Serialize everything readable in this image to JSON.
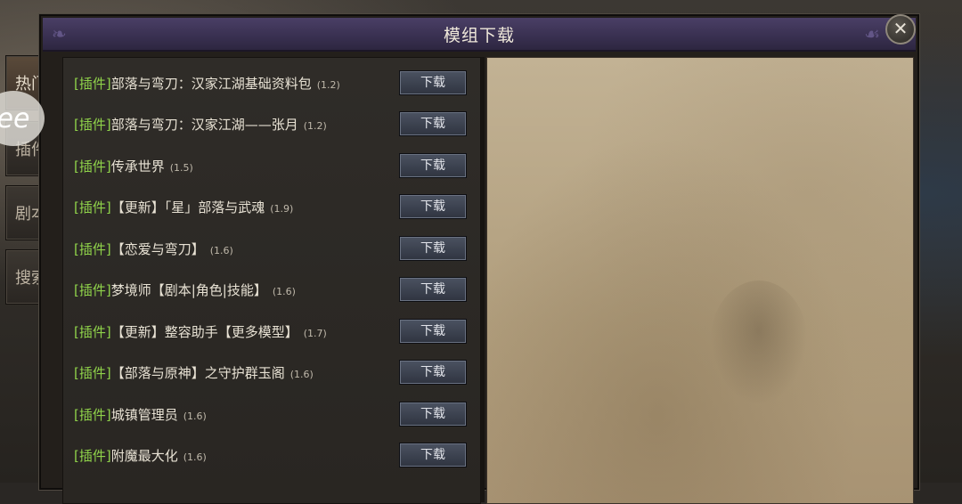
{
  "window": {
    "title": "模组下载",
    "close_icon": "close-icon"
  },
  "side_tabs": [
    {
      "label": "热门",
      "active": true
    },
    {
      "label": "插件",
      "active": false
    },
    {
      "label": "剧本",
      "active": false
    },
    {
      "label": "搜索",
      "active": false
    }
  ],
  "mods": [
    {
      "tag": "[插件]",
      "name": "部落与弯刀：汉家江湖基础资料包",
      "version": "(1.2)",
      "button": "下载"
    },
    {
      "tag": "[插件]",
      "name": "部落与弯刀：汉家江湖——张月",
      "version": "(1.2)",
      "button": "下载"
    },
    {
      "tag": "[插件]",
      "name": "传承世界",
      "version": "(1.5)",
      "button": "下载"
    },
    {
      "tag": "[插件]",
      "name": "【更新】「星」部落与武魂",
      "version": "(1.9)",
      "button": "下载"
    },
    {
      "tag": "[插件]",
      "name": "【恋爱与弯刀】",
      "version": "(1.6)",
      "button": "下载"
    },
    {
      "tag": "[插件]",
      "name": "梦境师【剧本|角色|技能】",
      "version": "(1.6)",
      "button": "下载"
    },
    {
      "tag": "[插件]",
      "name": "【更新】整容助手【更多模型】",
      "version": "(1.7)",
      "button": "下载"
    },
    {
      "tag": "[插件]",
      "name": "【部落与原神】之守护群玉阁",
      "version": "(1.6)",
      "button": "下载"
    },
    {
      "tag": "[插件]",
      "name": "城镇管理员",
      "version": "(1.6)",
      "button": "下载"
    },
    {
      "tag": "[插件]",
      "name": "附魔最大化",
      "version": "(1.6)",
      "button": "下载"
    }
  ],
  "overlay": {
    "text": "ee"
  }
}
